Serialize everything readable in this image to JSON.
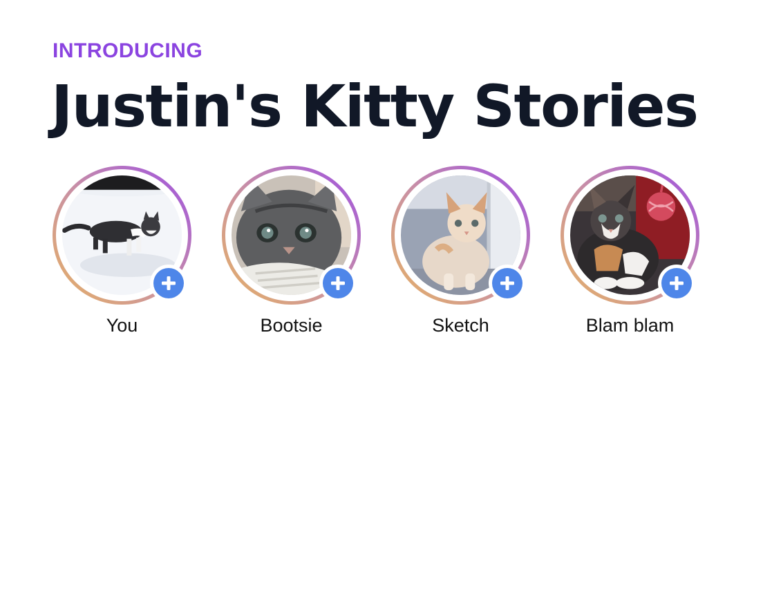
{
  "header": {
    "eyebrow": "INTRODUCING",
    "title": "Justin's Kitty Stories"
  },
  "colors": {
    "eyebrow": "#8b44e0",
    "title": "#111827",
    "ring_gradient": [
      "#e6b264",
      "#c88fa6",
      "#9d4fe3"
    ],
    "add_button": "#4e86e9"
  },
  "stories": [
    {
      "label": "You",
      "image": "gray-tabby-kitten-walking-in-snow",
      "icon": "plus-icon"
    },
    {
      "label": "Bootsie",
      "image": "fluffy-gray-kitten-closeup",
      "icon": "plus-icon"
    },
    {
      "label": "Sketch",
      "image": "cream-orange-kitten-sitting",
      "icon": "plus-icon"
    },
    {
      "label": "Blam blam",
      "image": "calico-kitten-with-red-yarn-ball",
      "icon": "plus-icon"
    }
  ]
}
